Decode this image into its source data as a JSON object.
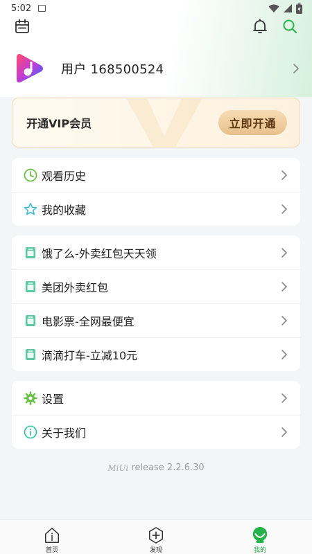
{
  "status_bar": {
    "time": "5:02"
  },
  "profile": {
    "username": "用户 168500524"
  },
  "vip": {
    "title": "开通VIP会员",
    "button_label": "立即开通"
  },
  "menu_group_1": [
    {
      "label": "观看历史",
      "icon": "clock-icon"
    },
    {
      "label": "我的收藏",
      "icon": "star-icon"
    }
  ],
  "menu_group_2": [
    {
      "label": "饿了么-外卖红包天天领",
      "icon": "coupon-icon"
    },
    {
      "label": "美团外卖红包",
      "icon": "coupon-icon"
    },
    {
      "label": "电影票-全网最便宜",
      "icon": "coupon-icon"
    },
    {
      "label": "滴滴打车-立减10元",
      "icon": "coupon-icon"
    }
  ],
  "menu_group_3": [
    {
      "label": "设置",
      "icon": "gear-icon"
    },
    {
      "label": "关于我们",
      "icon": "info-icon"
    }
  ],
  "version": {
    "brand": "MiUi",
    "text": "release 2.2.6.30"
  },
  "bottom_nav": [
    {
      "label": "首页",
      "icon": "home-icon"
    },
    {
      "label": "发现",
      "icon": "discover-icon"
    },
    {
      "label": "我的",
      "icon": "profile-icon",
      "active": true
    }
  ],
  "colors": {
    "accent_green": "#26b24a",
    "icon_teal": "#3fc6a8",
    "vip_gold": "#e8c08c"
  }
}
